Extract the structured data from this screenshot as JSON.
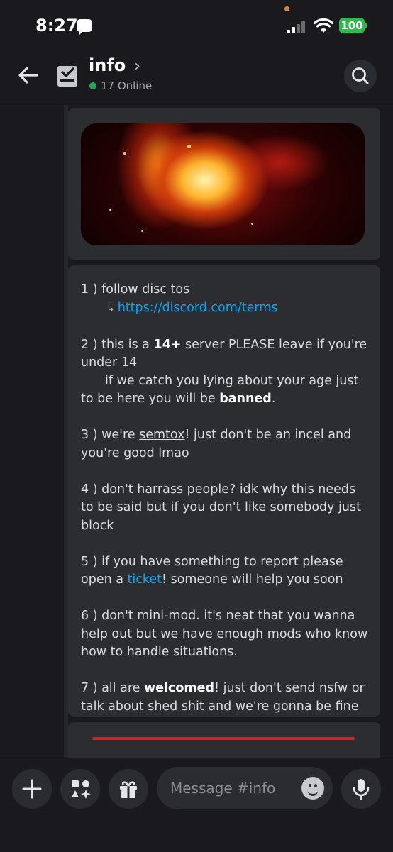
{
  "status_bar": {
    "time": "8:27",
    "battery": "100"
  },
  "header": {
    "channel_name": "info",
    "online_text": "17 Online"
  },
  "rules": {
    "r1": "1 ) follow disc tos",
    "r1_link": "https://discord.com/terms",
    "r2_a": "2 ) this is a ",
    "r2_bold": "14+",
    "r2_b": " server PLEASE leave if you're under 14",
    "r2_c": "if we catch you lying about your age just to be here you will be ",
    "r2_banned": "banned",
    "r2_end": ".",
    "r3_a": "3 ) we're ",
    "r3_u": "semtox",
    "r3_b": "! just don't be an incel and you're good lmao",
    "r4": "4 ) don't harrass people? idk why this needs to be said but if you don't like somebody just block",
    "r5_a": "5 ) if you have something to report please open a ",
    "r5_link": "ticket",
    "r5_b": "! someone will help you soon",
    "r6": "6 ) don't mini-mod. it's neat that you wanna help out but we have enough mods who know how to handle situations.",
    "r7_a": "7 ) all are ",
    "r7_bold": "welcomed",
    "r7_b": "! just don't send nsfw or talk about shed shit and we're gonna be fine"
  },
  "composer": {
    "placeholder": "Message #info"
  },
  "colors": {
    "link": "#00a8fc",
    "online": "#23a55a",
    "battery": "#2ebb4e"
  },
  "icons": [
    "back-arrow-icon",
    "channel-icon",
    "search-icon",
    "plus-icon",
    "apps-icon",
    "gift-icon",
    "emoji-icon",
    "microphone-icon"
  ]
}
